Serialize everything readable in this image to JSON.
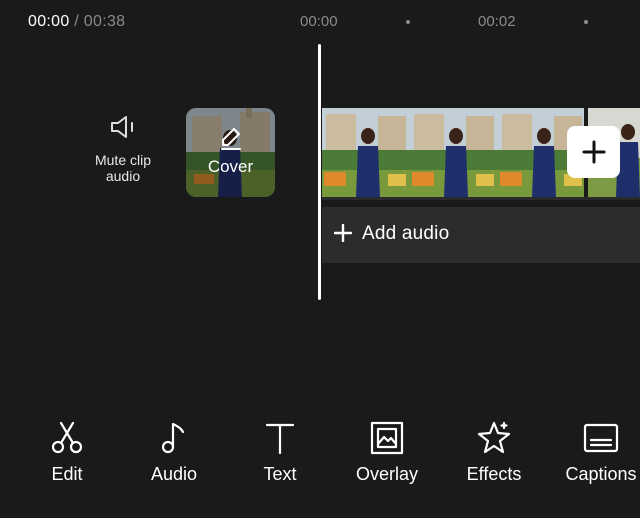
{
  "timeline": {
    "current_time": "00:00",
    "separator": " / ",
    "total_time": "00:38",
    "ruler_marks": [
      "00:00",
      "00:02"
    ]
  },
  "mute_clip": {
    "label": "Mute clip audio",
    "icon": "speaker-icon"
  },
  "cover": {
    "label": "Cover",
    "icon": "pencil-icon"
  },
  "video_track": {
    "add_icon": "plus-icon"
  },
  "audio_track": {
    "label": "Add audio",
    "icon": "plus-icon"
  },
  "toolbar": {
    "items": [
      {
        "label": "Edit",
        "icon": "scissors-icon"
      },
      {
        "label": "Audio",
        "icon": "music-note-icon"
      },
      {
        "label": "Text",
        "icon": "text-icon"
      },
      {
        "label": "Overlay",
        "icon": "overlay-icon"
      },
      {
        "label": "Effects",
        "icon": "star-icon"
      },
      {
        "label": "Captions",
        "icon": "captions-icon"
      }
    ]
  },
  "colors": {
    "background": "#1a1a1a",
    "audio_track": "#2c2c2c",
    "muted_text": "#8a8a8a",
    "accent": "#ffffff"
  }
}
